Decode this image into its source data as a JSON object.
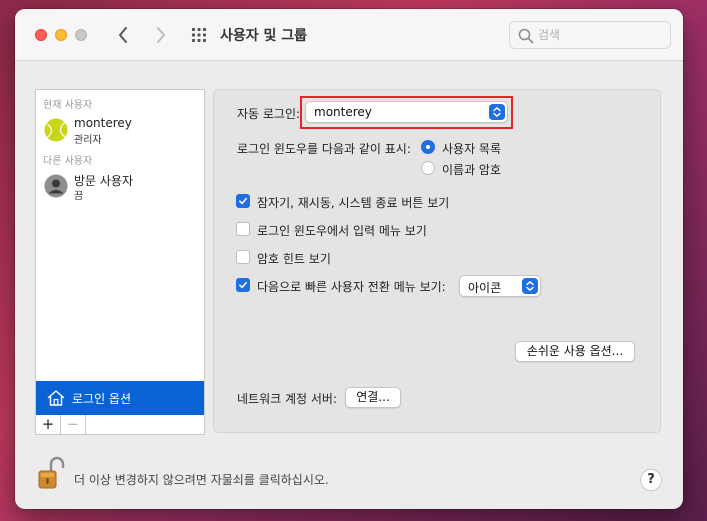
{
  "window": {
    "title": "사용자 및 그룹"
  },
  "search": {
    "placeholder": "검색",
    "value": ""
  },
  "sidebar": {
    "current_users_label": "현재 사용자",
    "current_user": {
      "name": "monterey",
      "role": "관리자"
    },
    "other_users_label": "다른 사용자",
    "guest_user": {
      "name": "방문 사용자",
      "role": "끔"
    },
    "login_options_label": "로그인 옵션",
    "add_label": "+",
    "remove_label": "−"
  },
  "login_options": {
    "auto_login_label": "자동 로그인:",
    "auto_login_value": "monterey",
    "display_window_label": "로그인 윈도우를 다음과 같이 표시:",
    "display_options": [
      {
        "label": "사용자 목록",
        "selected": true
      },
      {
        "label": "이름과 암호",
        "selected": false
      }
    ],
    "checkboxes": [
      {
        "label": "잠자기, 재시동, 시스템 종료 버튼 보기",
        "checked": true
      },
      {
        "label": "로그인 윈도우에서 입력 메뉴 보기",
        "checked": false
      },
      {
        "label": "암호 힌트 보기",
        "checked": false
      },
      {
        "label": "다음으로 빠른 사용자 전환 메뉴 보기:",
        "checked": true
      }
    ],
    "fast_switch_value": "아이콘",
    "accessibility_button": "손쉬운 사용 옵션...",
    "network_server_label": "네트워크 계정 서버:",
    "connect_button": "연결..."
  },
  "footer": {
    "lock_text": "더 이상 변경하지 않으려면 자물쇠를 클릭하십시오.",
    "help_label": "?"
  },
  "colors": {
    "accent": "#1f6fe0",
    "selection": "#0a63d4",
    "highlight_box": "#e3242b"
  }
}
